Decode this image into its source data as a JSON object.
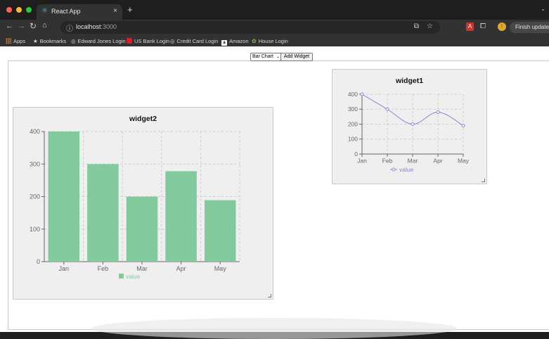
{
  "browser": {
    "tab_title": "React App",
    "tab_close": "×",
    "new_tab": "+",
    "url_host": "localhost",
    "url_port": ":3000",
    "finish_update": "Finish update",
    "avatar_letter": "!",
    "bookmarks": [
      {
        "label": "Apps",
        "icon": "apps-grid-icon"
      },
      {
        "label": "Bookmarks",
        "icon": "star-icon"
      },
      {
        "label": "Edward Jones Login",
        "icon": "globe-icon"
      },
      {
        "label": "US Bank Login",
        "icon": "bank-icon"
      },
      {
        "label": "Credit Card Login",
        "icon": "globe-icon"
      },
      {
        "label": "Amazon",
        "icon": "amazon-icon"
      },
      {
        "label": "House Login",
        "icon": "house-icon"
      }
    ]
  },
  "controls": {
    "chart_type": "Bar Chart",
    "add_widget": "Add Widget"
  },
  "widgets": {
    "widget1": {
      "title": "widget1"
    },
    "widget2": {
      "title": "widget2"
    }
  },
  "chart_data": [
    {
      "type": "line",
      "title": "widget1",
      "categories": [
        "Jan",
        "Feb",
        "Mar",
        "Apr",
        "May"
      ],
      "series": [
        {
          "name": "value",
          "values": [
            400,
            300,
            200,
            280,
            190
          ]
        }
      ],
      "ylim": [
        0,
        400
      ],
      "yticks": [
        0,
        100,
        200,
        300,
        400
      ],
      "grid": true,
      "legend": "bottom",
      "color": "#8884d8"
    },
    {
      "type": "bar",
      "title": "widget2",
      "categories": [
        "Jan",
        "Feb",
        "Mar",
        "Apr",
        "May"
      ],
      "series": [
        {
          "name": "value",
          "values": [
            400,
            300,
            200,
            278,
            189
          ]
        }
      ],
      "ylim": [
        0,
        400
      ],
      "yticks": [
        0,
        100,
        200,
        300,
        400
      ],
      "grid": true,
      "legend": "bottom",
      "color": "#82ca9d"
    }
  ]
}
